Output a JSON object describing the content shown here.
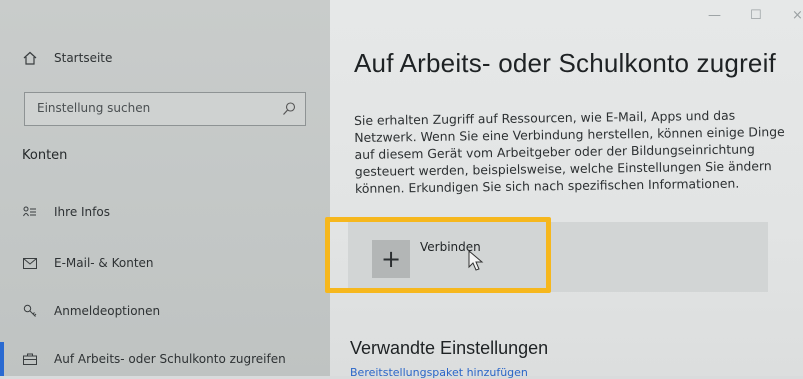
{
  "sidebar": {
    "home_label": "Startseite",
    "search_placeholder": "Einstellung suchen",
    "section_title": "Konten",
    "items": [
      {
        "label": "Ihre Infos",
        "icon": "person-list-icon"
      },
      {
        "label": "E-Mail- & Konten",
        "icon": "mail-icon"
      },
      {
        "label": "Anmeldeoptionen",
        "icon": "key-icon"
      },
      {
        "label": "Auf Arbeits- oder Schulkonto zugreifen",
        "icon": "briefcase-icon",
        "active": true
      }
    ]
  },
  "window": {
    "minimize": "—",
    "maximize": "☐",
    "close": "×"
  },
  "main": {
    "title": "Auf Arbeits- oder Schulkonto zugreif",
    "description": "Sie erhalten Zugriff auf Ressourcen, wie E-Mail, Apps und das Netzwerk. Wenn Sie eine Verbindung herstellen, können einige Dinge auf diesem Gerät vom Arbeitgeber oder der Bildungseinrichtung gesteuert werden, beispielsweise, welche Einstellungen Sie ändern können. Erkundigen Sie sich nach spezifischen Informationen.",
    "connect_label": "Verbinden",
    "plus_glyph": "+",
    "related_title": "Verwandte Einstellungen",
    "related_link": "Bereitstellungspaket hinzufügen"
  },
  "colors": {
    "highlight": "#f6b71d",
    "accent": "#2a6ad1"
  }
}
